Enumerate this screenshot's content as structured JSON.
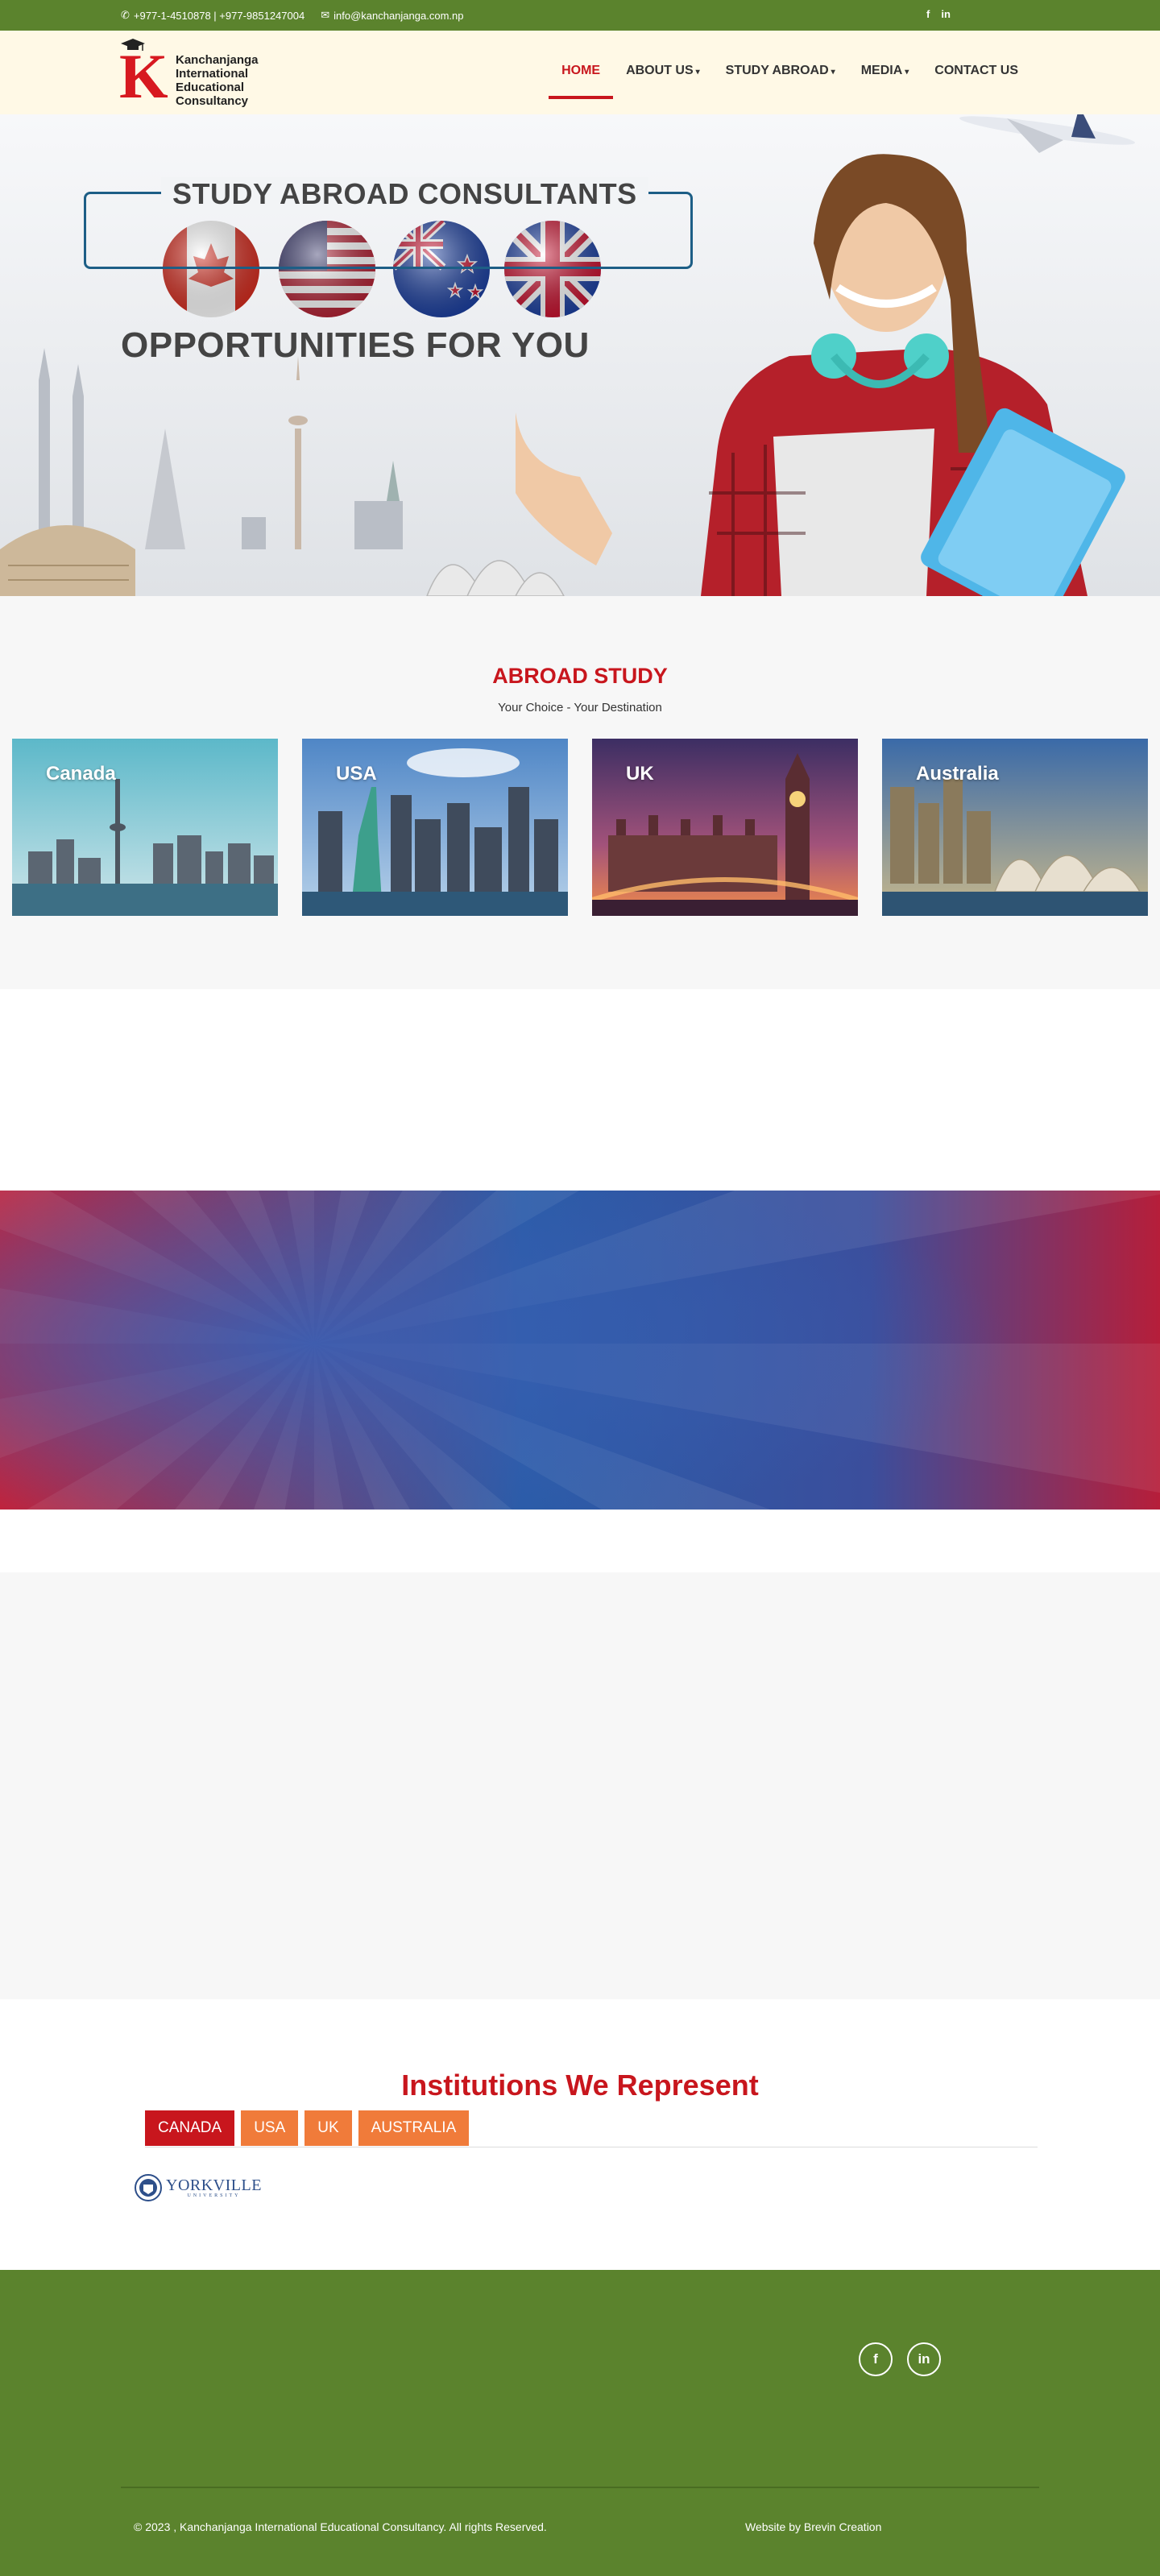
{
  "topbar": {
    "phone": "+977-1-4510878 | +977-9851247004",
    "email": "info@kanchanjanga.com.np",
    "social": [
      "f",
      "in"
    ]
  },
  "brand": {
    "letter": "K",
    "line1": "Kanchanjanga",
    "line2": "International",
    "line3": "Educational",
    "line4": "Consultancy"
  },
  "nav": {
    "items": [
      {
        "label": "HOME",
        "dropdown": false,
        "active": true
      },
      {
        "label": "ABOUT US",
        "dropdown": true
      },
      {
        "label": "STUDY ABROAD",
        "dropdown": true
      },
      {
        "label": "MEDIA",
        "dropdown": true
      },
      {
        "label": "CONTACT US",
        "dropdown": false
      }
    ],
    "caret": "▾"
  },
  "hero": {
    "title": "STUDY ABROAD CONSULTANTS",
    "subtitle": "OPPORTUNITIES FOR YOU"
  },
  "abroad": {
    "heading": "ABROAD STUDY",
    "tagline": "Your Choice - Your Destination",
    "cards": [
      "Canada",
      "USA",
      "UK",
      "Australia"
    ]
  },
  "institutions": {
    "heading": "Institutions We Represent",
    "tabs": [
      "CANADA",
      "USA",
      "UK",
      "AUSTRALIA"
    ],
    "logo_name": "YORKVILLE",
    "logo_small": "UNIVERSITY"
  },
  "footer": {
    "copyright": "© 2023 , Kanchanjanga International Educational Consultancy. All rights Reserved.",
    "credit": "Website by Brevin Creation",
    "social": [
      "f",
      "in"
    ]
  },
  "colors": {
    "green": "#5b832d",
    "red": "#c8161d",
    "orange": "#f07b3a",
    "cream": "#fff9e6"
  },
  "icons": [
    "phone-icon",
    "envelope-icon",
    "facebook-icon",
    "linkedin-icon",
    "caret-down-icon",
    "airplane-icon"
  ]
}
